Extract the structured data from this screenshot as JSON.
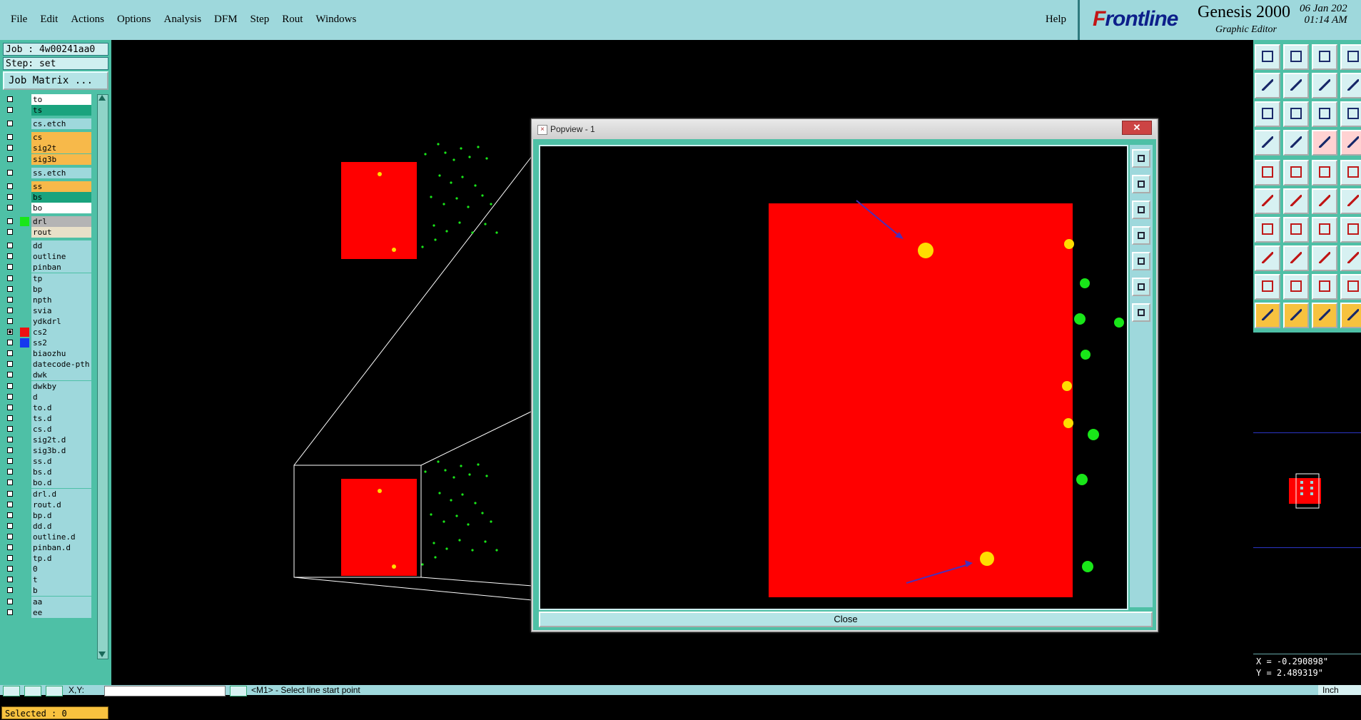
{
  "menubar": {
    "items": [
      "File",
      "Edit",
      "Actions",
      "Options",
      "Analysis",
      "DFM",
      "Step",
      "Rout",
      "Windows"
    ],
    "help": "Help"
  },
  "brand": {
    "logo": "Frontline",
    "product": "Genesis 2000",
    "subtitle": "Graphic Editor",
    "date": "06 Jan 202",
    "time": "01:14 AM"
  },
  "job": {
    "job": "Job : 4w00241aa0",
    "step": "Step: set",
    "matrix_button": "Job Matrix ..."
  },
  "layers": [
    {
      "name": "to",
      "color": "#ffffff",
      "checked": false
    },
    {
      "name": "ts",
      "color": "#1aa37e",
      "checked": false
    },
    {
      "name": "cs.etch",
      "color": "#9ed8dc",
      "checked": false
    },
    {
      "name": "cs",
      "color": "#f7b94a",
      "checked": false
    },
    {
      "name": "sig2t",
      "color": "#f7b94a",
      "checked": false
    },
    {
      "name": "sig3b",
      "color": "#f7b94a",
      "checked": false
    },
    {
      "name": "ss.etch",
      "color": "#9ed8dc",
      "checked": false
    },
    {
      "name": "ss",
      "color": "#f7b94a",
      "checked": false
    },
    {
      "name": "bs",
      "color": "#1aa37e",
      "checked": false
    },
    {
      "name": "bo",
      "color": "#ffffff",
      "checked": false
    },
    {
      "name": "drl",
      "color": "#b4b4b4",
      "checked": false,
      "swatch": "#19e619"
    },
    {
      "name": "rout",
      "color": "#e8e0c8",
      "checked": false
    },
    {
      "name": "dd",
      "color": "#9ed8dc",
      "checked": false
    },
    {
      "name": "outline",
      "color": "#9ed8dc",
      "checked": false
    },
    {
      "name": "pinban",
      "color": "#9ed8dc",
      "checked": false
    },
    {
      "name": "tp",
      "color": "#9ed8dc",
      "checked": false
    },
    {
      "name": "bp",
      "color": "#9ed8dc",
      "checked": false
    },
    {
      "name": "npth",
      "color": "#9ed8dc",
      "checked": false
    },
    {
      "name": "svia",
      "color": "#9ed8dc",
      "checked": false
    },
    {
      "name": "ydkdrl",
      "color": "#9ed8dc",
      "checked": false
    },
    {
      "name": "cs2",
      "color": "#9ed8dc",
      "checked": true,
      "swatch": "#ee1111"
    },
    {
      "name": "ss2",
      "color": "#9ed8dc",
      "checked": false,
      "swatch": "#1638ee"
    },
    {
      "name": "biaozhu",
      "color": "#9ed8dc",
      "checked": false
    },
    {
      "name": "datecode-pth",
      "color": "#9ed8dc",
      "checked": false
    },
    {
      "name": "dwk",
      "color": "#9ed8dc",
      "checked": false
    },
    {
      "name": "dwkby",
      "color": "#9ed8dc",
      "checked": false
    },
    {
      "name": "d",
      "color": "#9ed8dc",
      "checked": false
    },
    {
      "name": "to.d",
      "color": "#9ed8dc",
      "checked": false
    },
    {
      "name": "ts.d",
      "color": "#9ed8dc",
      "checked": false
    },
    {
      "name": "cs.d",
      "color": "#9ed8dc",
      "checked": false
    },
    {
      "name": "sig2t.d",
      "color": "#9ed8dc",
      "checked": false
    },
    {
      "name": "sig3b.d",
      "color": "#9ed8dc",
      "checked": false
    },
    {
      "name": "ss.d",
      "color": "#9ed8dc",
      "checked": false
    },
    {
      "name": "bs.d",
      "color": "#9ed8dc",
      "checked": false
    },
    {
      "name": "bo.d",
      "color": "#9ed8dc",
      "checked": false
    },
    {
      "name": "drl.d",
      "color": "#9ed8dc",
      "checked": false
    },
    {
      "name": "rout.d",
      "color": "#9ed8dc",
      "checked": false
    },
    {
      "name": "bp.d",
      "color": "#9ed8dc",
      "checked": false
    },
    {
      "name": "dd.d",
      "color": "#9ed8dc",
      "checked": false
    },
    {
      "name": "outline.d",
      "color": "#9ed8dc",
      "checked": false
    },
    {
      "name": "pinban.d",
      "color": "#9ed8dc",
      "checked": false
    },
    {
      "name": "tp.d",
      "color": "#9ed8dc",
      "checked": false
    },
    {
      "name": "0",
      "color": "#9ed8dc",
      "checked": false
    },
    {
      "name": "t",
      "color": "#9ed8dc",
      "checked": false
    },
    {
      "name": "b",
      "color": "#9ed8dc",
      "checked": false
    },
    {
      "name": "aa",
      "color": "#9ed8dc",
      "checked": false
    },
    {
      "name": "ee",
      "color": "#9ed8dc",
      "checked": false
    }
  ],
  "selected": "Selected : 0",
  "popview": {
    "title": "Popview - 1",
    "close_label": "Close",
    "close_x": "✕"
  },
  "coords": {
    "x": "X = -0.290898\"",
    "y": "Y = 2.489319\""
  },
  "statusbar": {
    "xy_label": "X,Y:",
    "message": "<M1> - Select line start point",
    "units": "Inch"
  },
  "colors": {
    "panel": "#4ec0a6",
    "menubar": "#9ed8dc",
    "copper": "#ff0000",
    "pad": "#ffdd00",
    "drill": "#19e619",
    "arrow": "#4b2fb8"
  }
}
